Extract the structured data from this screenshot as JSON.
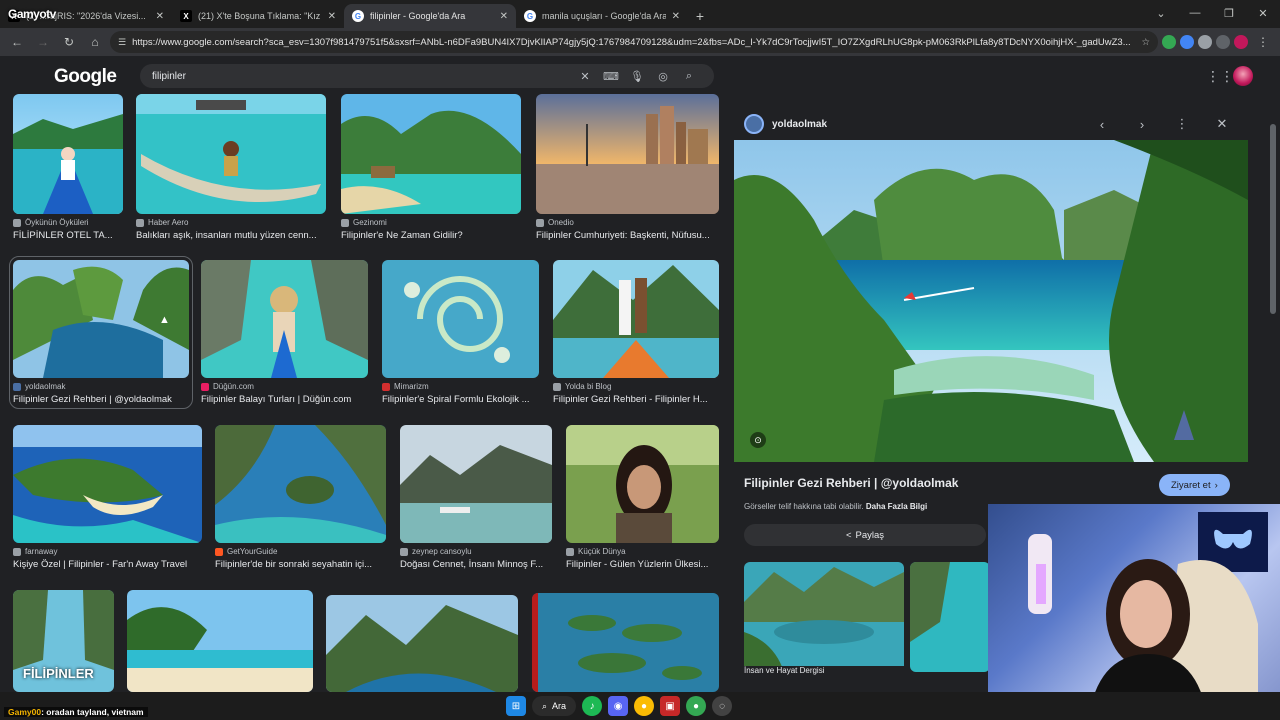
{
  "browser": {
    "tabs": [
      {
        "title": "(2) ...rajRIS: \"2026'da Vizesi...",
        "icon": "x-logo-icon",
        "active": false
      },
      {
        "title": "(21) X'te Boşuna Tıklama: \"Kız k...",
        "icon": "x-logo-icon",
        "active": false
      },
      {
        "title": "filipinler - Google'da Ara",
        "icon": "google-icon",
        "active": true
      },
      {
        "title": "manila uçuşları - Google'da Ara",
        "icon": "google-icon",
        "active": false
      }
    ],
    "overlay_logo": "Gamyotv",
    "url": "https://www.google.com/search?sca_esv=1307f981479751f5&sxsrf=ANbL-n6DFa9BUN4IX7DjvKlIAP74gjy5jQ:1767984709128&udm=2&fbs=ADc_l-Yk7dC9rTocjjwI5T_IO7ZXgdRLhUG8pk-pM063RkPlLfa8y8TDcNYX0oihjHX-_gadUwZ3..."
  },
  "google": {
    "logo": "Google",
    "query": "filipinler"
  },
  "results": [
    {
      "source": "Öykünün Öyküleri",
      "caption": "FİLİPİNLER OTEL TA..."
    },
    {
      "source": "Haber Aero",
      "caption": "Balıkları aşık, insanları mutlu yüzen cenn..."
    },
    {
      "source": "Gezinomi",
      "caption": "Filipinler'e Ne Zaman Gidilir?"
    },
    {
      "source": "Onedio",
      "caption": "Filipinler Cumhuriyeti: Başkenti, Nüfusu..."
    },
    {
      "source": "yoldaolmak",
      "caption": "Filipinler Gezi Rehberi | @yoldaolmak"
    },
    {
      "source": "Düğün.com",
      "caption": "Filipinler Balayı Turları | Düğün.com"
    },
    {
      "source": "Mimarizm",
      "caption": "Filipinler'e Spiral Formlu Ekolojik ..."
    },
    {
      "source": "Yolda bi Blog",
      "caption": "Filipinler Gezi Rehberi - Filipinler H..."
    },
    {
      "source": "farnaway",
      "caption": "Kişiye Özel | Filipinler - Far'n Away Travel"
    },
    {
      "source": "GetYourGuide",
      "caption": "Filipinler'de bir sonraki seyahatin içi..."
    },
    {
      "source": "zeynep cansoylu",
      "caption": "Doğası Cennet, İnsanı Minnoş F..."
    },
    {
      "source": "Küçük Dünya",
      "caption": "Filipinler - Gülen Yüzlerin Ülkesi..."
    }
  ],
  "bottom_thumb_text": "FİLİPİNLER",
  "panel": {
    "site": "yoldaolmak",
    "title": "Filipinler Gezi Rehberi | @yoldaolmak",
    "visit_label": "Ziyaret et",
    "copyright_text": "Görseller telif hakkına tabi olabilir.",
    "copyright_link": "Daha Fazla Bilgi",
    "share_label": "Paylaş",
    "related_caption": "İnsan ve Hayat Dergisi"
  },
  "taskbar": {
    "search_label": "Ara",
    "chat_user": "Gamy00",
    "chat_message": ": oradan tayland, vietnam"
  }
}
